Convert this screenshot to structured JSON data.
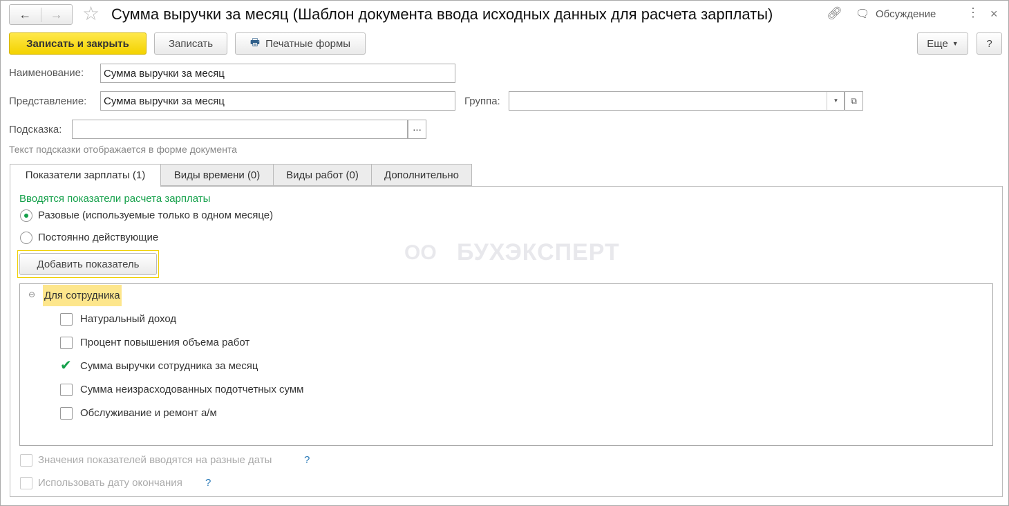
{
  "window": {
    "title": "Сумма выручки за месяц (Шаблон документа ввода исходных данных для расчета зарплаты)",
    "discussion": "Обсуждение"
  },
  "toolbar": {
    "save_close": "Записать и закрыть",
    "save": "Записать",
    "print_forms": "Печатные формы",
    "more": "Еще",
    "help": "?"
  },
  "form": {
    "name_label": "Наименование:",
    "name_value": "Сумма выручки за месяц",
    "repr_label": "Представление:",
    "repr_value": "Сумма выручки за месяц",
    "group_label": "Группа:",
    "group_value": "",
    "hint_label": "Подсказка:",
    "hint_value": "",
    "hint_button": "...",
    "hint_note": "Текст подсказки отображается в форме документа"
  },
  "tabs": [
    {
      "label": "Показатели зарплаты (1)",
      "active": true
    },
    {
      "label": "Виды времени (0)"
    },
    {
      "label": "Виды работ (0)"
    },
    {
      "label": "Дополнительно"
    }
  ],
  "panel": {
    "section_title": "Вводятся показатели расчета зарплаты",
    "radio_once": "Разовые (используемые только в одном месяце)",
    "radio_permanent": "Постоянно действующие",
    "radio_selected": "once",
    "add_button": "Добавить показатель",
    "group": "Для сотрудника",
    "items": [
      {
        "label": "Натуральный доход",
        "checked": false
      },
      {
        "label": "Процент повышения объема работ",
        "checked": false
      },
      {
        "label": "Сумма выручки сотрудника за месяц",
        "checked": true
      },
      {
        "label": "Сумма неизрасходованных подотчетных сумм",
        "checked": false
      },
      {
        "label": "Обслуживание и ремонт а/м",
        "checked": false
      }
    ],
    "opt_dates": "Значения показателей вводятся на разные даты",
    "opt_end": "Использовать дату окончания",
    "help_mark": "?"
  },
  "watermark": "БУХЭКСПЕРТ",
  "colors": {
    "accent_yellow": "#f5d800",
    "green": "#14a04a",
    "link_blue": "#2a7ab8"
  }
}
